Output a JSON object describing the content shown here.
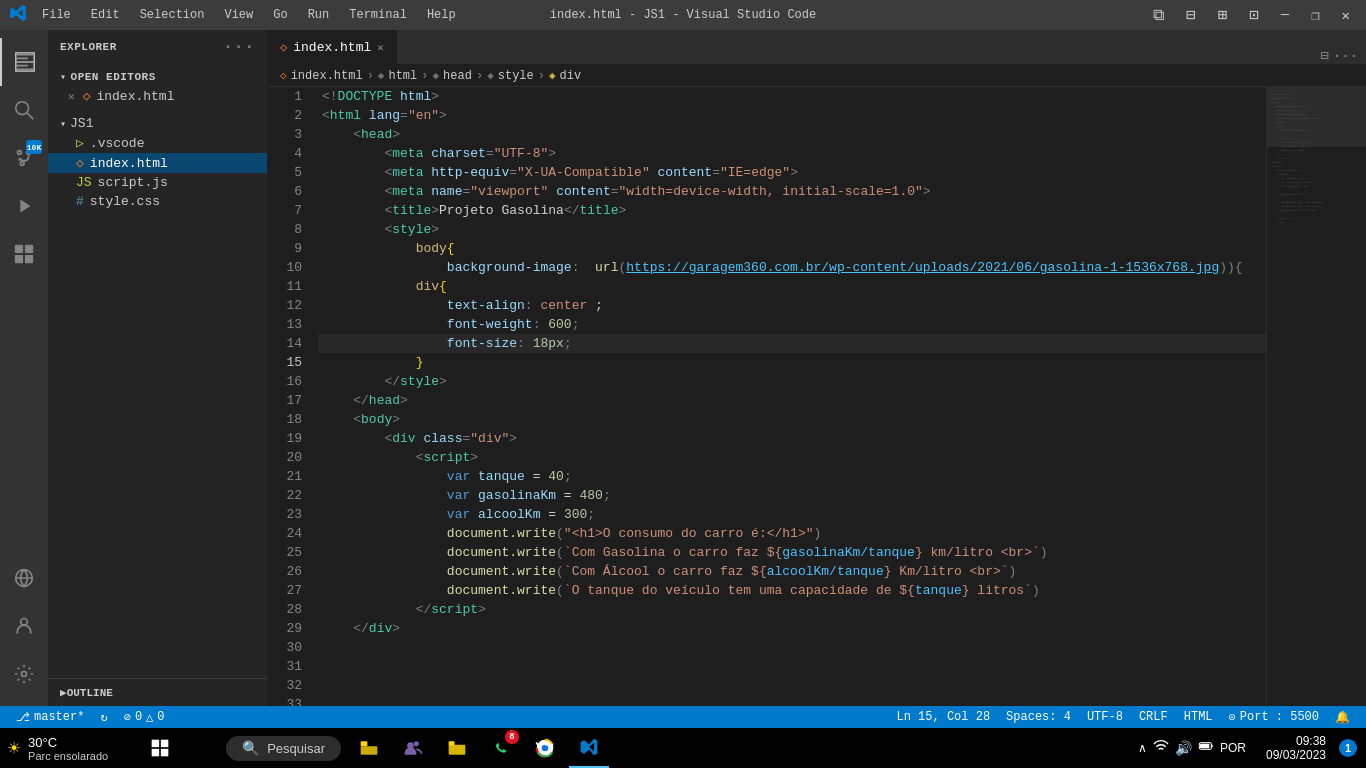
{
  "titlebar": {
    "logo": "✦",
    "menu": [
      "File",
      "Edit",
      "Selection",
      "View",
      "Go",
      "Run",
      "Terminal",
      "Help"
    ],
    "title": "index.html - JS1 - Visual Studio Code",
    "controls": {
      "minimize": "─",
      "maximize": "□",
      "restore": "❐",
      "close": "✕"
    }
  },
  "activity_bar": {
    "items": [
      {
        "name": "explorer",
        "icon": "⧉",
        "active": true
      },
      {
        "name": "search",
        "icon": "🔍"
      },
      {
        "name": "source-control",
        "icon": "⎇",
        "badge": "10K"
      },
      {
        "name": "run-debug",
        "icon": "▷"
      },
      {
        "name": "extensions",
        "icon": "⊞"
      }
    ],
    "bottom": [
      {
        "name": "remote",
        "icon": "⊙"
      },
      {
        "name": "accounts",
        "icon": "👤"
      },
      {
        "name": "settings",
        "icon": "⚙"
      }
    ]
  },
  "sidebar": {
    "title": "EXPLORER",
    "open_editors": {
      "label": "OPEN EDITORS",
      "items": [
        {
          "name": "index.html",
          "type": "html",
          "close": true
        }
      ]
    },
    "js1": {
      "label": "JS1",
      "items": [
        {
          "name": ".vscode",
          "type": "folder"
        },
        {
          "name": "index.html",
          "type": "html",
          "active": true
        },
        {
          "name": "script.js",
          "type": "js"
        },
        {
          "name": "style.css",
          "type": "css"
        }
      ]
    },
    "outline": {
      "label": "OUTLINE"
    }
  },
  "editor": {
    "tab": {
      "icon": "◇",
      "name": "index.html",
      "modified": false
    },
    "breadcrumb": [
      "index.html",
      "html",
      "head",
      "style",
      "div"
    ],
    "lines": [
      {
        "num": 1,
        "tokens": [
          {
            "t": "punct",
            "v": "<!"
          },
          {
            "t": "tagname",
            "v": "DOCTYPE"
          },
          {
            "t": "text",
            "v": " "
          },
          {
            "t": "attr",
            "v": "html"
          },
          {
            "t": "punct",
            "v": ">"
          }
        ]
      },
      {
        "num": 2,
        "tokens": [
          {
            "t": "punct",
            "v": "<"
          },
          {
            "t": "tagname",
            "v": "html"
          },
          {
            "t": "text",
            "v": " "
          },
          {
            "t": "attr",
            "v": "lang"
          },
          {
            "t": "punct",
            "v": "="
          },
          {
            "t": "attrval",
            "v": "\"en\""
          },
          {
            "t": "punct",
            "v": ">"
          }
        ]
      },
      {
        "num": 3,
        "tokens": [
          {
            "t": "text",
            "v": "    "
          },
          {
            "t": "punct",
            "v": "<"
          },
          {
            "t": "tagname",
            "v": "head"
          },
          {
            "t": "punct",
            "v": ">"
          }
        ]
      },
      {
        "num": 4,
        "tokens": [
          {
            "t": "text",
            "v": "        "
          },
          {
            "t": "punct",
            "v": "<"
          },
          {
            "t": "tagname",
            "v": "meta"
          },
          {
            "t": "text",
            "v": " "
          },
          {
            "t": "attr",
            "v": "charset"
          },
          {
            "t": "punct",
            "v": "="
          },
          {
            "t": "attrval",
            "v": "\"UTF-8\""
          },
          {
            "t": "punct",
            "v": ">"
          }
        ]
      },
      {
        "num": 5,
        "tokens": [
          {
            "t": "text",
            "v": "        "
          },
          {
            "t": "punct",
            "v": "<"
          },
          {
            "t": "tagname",
            "v": "meta"
          },
          {
            "t": "text",
            "v": " "
          },
          {
            "t": "attr",
            "v": "http-equiv"
          },
          {
            "t": "punct",
            "v": "="
          },
          {
            "t": "attrval",
            "v": "\"X-UA-Compatible\""
          },
          {
            "t": "text",
            "v": " "
          },
          {
            "t": "attr",
            "v": "content"
          },
          {
            "t": "punct",
            "v": "="
          },
          {
            "t": "attrval",
            "v": "\"IE=edge\""
          },
          {
            "t": "punct",
            "v": ">"
          }
        ]
      },
      {
        "num": 6,
        "tokens": [
          {
            "t": "text",
            "v": "        "
          },
          {
            "t": "punct",
            "v": "<"
          },
          {
            "t": "tagname",
            "v": "meta"
          },
          {
            "t": "text",
            "v": " "
          },
          {
            "t": "attr",
            "v": "name"
          },
          {
            "t": "punct",
            "v": "="
          },
          {
            "t": "attrval",
            "v": "\"viewport\""
          },
          {
            "t": "text",
            "v": " "
          },
          {
            "t": "attr",
            "v": "content"
          },
          {
            "t": "punct",
            "v": "="
          },
          {
            "t": "attrval",
            "v": "\"width=device-width, initial-scale=1.0\""
          },
          {
            "t": "punct",
            "v": ">"
          }
        ]
      },
      {
        "num": 7,
        "tokens": [
          {
            "t": "text",
            "v": "        "
          },
          {
            "t": "punct",
            "v": "<"
          },
          {
            "t": "tagname",
            "v": "title"
          },
          {
            "t": "punct",
            "v": ">"
          },
          {
            "t": "text",
            "v": "Projeto Gasolina"
          },
          {
            "t": "punct",
            "v": "</"
          },
          {
            "t": "tagname",
            "v": "title"
          },
          {
            "t": "punct",
            "v": ">"
          }
        ]
      },
      {
        "num": 8,
        "tokens": [
          {
            "t": "text",
            "v": "        "
          },
          {
            "t": "punct",
            "v": "<"
          },
          {
            "t": "tagname",
            "v": "style"
          },
          {
            "t": "punct",
            "v": ">"
          }
        ]
      },
      {
        "num": 9,
        "tokens": [
          {
            "t": "text",
            "v": "            "
          },
          {
            "t": "selector",
            "v": "body"
          },
          {
            "t": "bracket",
            "v": "{"
          }
        ]
      },
      {
        "num": 10,
        "tokens": [
          {
            "t": "text",
            "v": "                "
          },
          {
            "t": "prop",
            "v": "background-image"
          },
          {
            "t": "punct",
            "v": ":  "
          },
          {
            "t": "func",
            "v": "url"
          },
          {
            "t": "punct",
            "v": "("
          },
          {
            "t": "link",
            "v": "https://garagem360.com.br/wp-content/uploads/2021/06/gasolina-1-1536x768.jpg"
          },
          {
            "t": "punct",
            "v": ")){"
          }
        ]
      },
      {
        "num": 11,
        "tokens": [
          {
            "t": "text",
            "v": ""
          }
        ]
      },
      {
        "num": 12,
        "tokens": [
          {
            "t": "text",
            "v": "            "
          },
          {
            "t": "selector",
            "v": "div"
          },
          {
            "t": "bracket",
            "v": "{"
          }
        ]
      },
      {
        "num": 13,
        "tokens": [
          {
            "t": "text",
            "v": "                "
          },
          {
            "t": "prop",
            "v": "text-align"
          },
          {
            "t": "punct",
            "v": ": "
          },
          {
            "t": "value-str",
            "v": "center"
          },
          {
            "t": "text",
            "v": " ;"
          }
        ]
      },
      {
        "num": 14,
        "tokens": [
          {
            "t": "text",
            "v": "                "
          },
          {
            "t": "prop",
            "v": "font-weight"
          },
          {
            "t": "punct",
            "v": ": "
          },
          {
            "t": "num",
            "v": "600"
          },
          {
            "t": "punct",
            "v": ";"
          }
        ]
      },
      {
        "num": 15,
        "tokens": [
          {
            "t": "text",
            "v": "                "
          },
          {
            "t": "prop",
            "v": "font-size"
          },
          {
            "t": "punct",
            "v": ": "
          },
          {
            "t": "num",
            "v": "18px"
          },
          {
            "t": "punct",
            "v": ";"
          }
        ],
        "active": true
      },
      {
        "num": 16,
        "tokens": [
          {
            "t": "text",
            "v": "            "
          },
          {
            "t": "bracket",
            "v": "}"
          }
        ]
      },
      {
        "num": 17,
        "tokens": [
          {
            "t": "text",
            "v": "        "
          },
          {
            "t": "punct",
            "v": "</"
          },
          {
            "t": "tagname",
            "v": "style"
          },
          {
            "t": "punct",
            "v": ">"
          }
        ]
      },
      {
        "num": 18,
        "tokens": [
          {
            "t": "text",
            "v": "    "
          },
          {
            "t": "punct",
            "v": "</"
          },
          {
            "t": "tagname",
            "v": "head"
          },
          {
            "t": "punct",
            "v": ">"
          }
        ]
      },
      {
        "num": 19,
        "tokens": [
          {
            "t": "text",
            "v": "    "
          },
          {
            "t": "punct",
            "v": "<"
          },
          {
            "t": "tagname",
            "v": "body"
          },
          {
            "t": "punct",
            "v": ">"
          }
        ]
      },
      {
        "num": 20,
        "tokens": [
          {
            "t": "text",
            "v": "        "
          },
          {
            "t": "punct",
            "v": "<"
          },
          {
            "t": "tagname",
            "v": "div"
          },
          {
            "t": "text",
            "v": " "
          },
          {
            "t": "attr",
            "v": "class"
          },
          {
            "t": "punct",
            "v": "="
          },
          {
            "t": "attrval",
            "v": "\"div\""
          },
          {
            "t": "punct",
            "v": ">"
          }
        ]
      },
      {
        "num": 21,
        "tokens": [
          {
            "t": "text",
            "v": "            "
          },
          {
            "t": "punct",
            "v": "<"
          },
          {
            "t": "tagname",
            "v": "script"
          },
          {
            "t": "punct",
            "v": ">"
          }
        ]
      },
      {
        "num": 22,
        "tokens": [
          {
            "t": "text",
            "v": "                "
          },
          {
            "t": "keyword",
            "v": "var"
          },
          {
            "t": "text",
            "v": " "
          },
          {
            "t": "var",
            "v": "tanque"
          },
          {
            "t": "text",
            "v": " = "
          },
          {
            "t": "num",
            "v": "40"
          },
          {
            "t": "punct",
            "v": ";"
          }
        ]
      },
      {
        "num": 23,
        "tokens": [
          {
            "t": "text",
            "v": "                "
          },
          {
            "t": "keyword",
            "v": "var"
          },
          {
            "t": "text",
            "v": " "
          },
          {
            "t": "var",
            "v": "gasolinaKm"
          },
          {
            "t": "text",
            "v": " = "
          },
          {
            "t": "num",
            "v": "480"
          },
          {
            "t": "punct",
            "v": ";"
          }
        ]
      },
      {
        "num": 24,
        "tokens": [
          {
            "t": "text",
            "v": "                "
          },
          {
            "t": "keyword",
            "v": "var"
          },
          {
            "t": "text",
            "v": " "
          },
          {
            "t": "var",
            "v": "alcoolKm"
          },
          {
            "t": "text",
            "v": " = "
          },
          {
            "t": "num",
            "v": "300"
          },
          {
            "t": "punct",
            "v": ";"
          }
        ]
      },
      {
        "num": 25,
        "tokens": [
          {
            "t": "text",
            "v": ""
          }
        ]
      },
      {
        "num": 26,
        "tokens": [
          {
            "t": "text",
            "v": "                "
          },
          {
            "t": "func",
            "v": "document.write"
          },
          {
            "t": "punct",
            "v": "("
          },
          {
            "t": "attrval",
            "v": "\"<h1>O consumo do carro é:</h1>\""
          },
          {
            "t": "punct",
            "v": ")"
          }
        ]
      },
      {
        "num": 27,
        "tokens": [
          {
            "t": "text",
            "v": ""
          }
        ]
      },
      {
        "num": 28,
        "tokens": [
          {
            "t": "text",
            "v": "                "
          },
          {
            "t": "func",
            "v": "document.write"
          },
          {
            "t": "punct",
            "v": "("
          },
          {
            "t": "template",
            "v": "`Com Gasolina o carro faz ${"
          },
          {
            "t": "interp",
            "v": "gasolinaKm/tanque"
          },
          {
            "t": "template",
            "v": "} km/litro <br>`"
          },
          {
            "t": "punct",
            "v": ")"
          }
        ]
      },
      {
        "num": 29,
        "tokens": [
          {
            "t": "text",
            "v": "                "
          },
          {
            "t": "func",
            "v": "document.write"
          },
          {
            "t": "punct",
            "v": "("
          },
          {
            "t": "template",
            "v": "`Com Álcool o carro faz ${"
          },
          {
            "t": "interp",
            "v": "alcoolKm/tanque"
          },
          {
            "t": "template",
            "v": "} Km/litro <br>`"
          },
          {
            "t": "punct",
            "v": ")"
          }
        ]
      },
      {
        "num": 30,
        "tokens": [
          {
            "t": "text",
            "v": "                "
          },
          {
            "t": "func",
            "v": "document.write"
          },
          {
            "t": "punct",
            "v": "("
          },
          {
            "t": "template",
            "v": "`O tanque do veículo tem uma capacidade de ${"
          },
          {
            "t": "interp",
            "v": "tanque"
          },
          {
            "t": "template",
            "v": "} litros`"
          },
          {
            "t": "punct",
            "v": ")"
          }
        ]
      },
      {
        "num": 31,
        "tokens": [
          {
            "t": "text",
            "v": ""
          }
        ]
      },
      {
        "num": 32,
        "tokens": [
          {
            "t": "text",
            "v": "            "
          },
          {
            "t": "punct",
            "v": "</"
          },
          {
            "t": "tagname",
            "v": "script"
          },
          {
            "t": "punct",
            "v": ">"
          }
        ]
      },
      {
        "num": 33,
        "tokens": [
          {
            "t": "text",
            "v": "    "
          },
          {
            "t": "punct",
            "v": "</"
          },
          {
            "t": "tagname",
            "v": "div"
          },
          {
            "t": "punct",
            "v": ">"
          }
        ]
      }
    ]
  },
  "status_bar": {
    "left": [
      {
        "icon": "⎇",
        "text": "master*"
      },
      {
        "icon": "☁",
        "text": ""
      },
      {
        "icon": "⊘",
        "text": "0"
      },
      {
        "icon": "△",
        "text": "0"
      },
      {
        "icon": "",
        "text": "0"
      }
    ],
    "right": [
      {
        "text": "Ln 15, Col 28"
      },
      {
        "text": "Spaces: 4"
      },
      {
        "text": "UTF-8"
      },
      {
        "text": "CRLF"
      },
      {
        "text": "HTML"
      },
      {
        "icon": "⊙",
        "text": "Port : 5500"
      },
      {
        "icon": "🔔",
        "text": ""
      }
    ]
  },
  "taskbar": {
    "weather": {
      "temp": "30°C",
      "desc": "Parc ensolarado",
      "icon": "☀"
    },
    "start_icon": "⊞",
    "search": {
      "placeholder": "Pesquisar",
      "icon": "🔍"
    },
    "apps": [
      {
        "name": "file-explorer",
        "icon": "📁"
      },
      {
        "name": "teams",
        "icon": "👥",
        "color": "#7b5ea7"
      },
      {
        "name": "file-manager",
        "icon": "📂"
      },
      {
        "name": "whatsapp",
        "icon": "💬",
        "badge": "8"
      },
      {
        "name": "chrome",
        "icon": "🌐"
      },
      {
        "name": "vscode",
        "icon": "◈",
        "active": true
      }
    ],
    "system": {
      "lang": "POR",
      "wifi": "WiFi",
      "speaker": "🔊",
      "battery": "🔋",
      "time": "09:38",
      "date": "09/03/2023",
      "notification_badge": "1"
    }
  }
}
